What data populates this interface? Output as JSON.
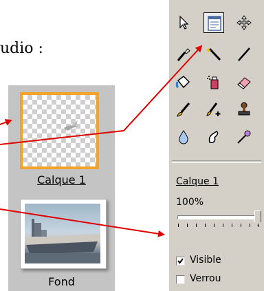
{
  "intro_text": "udio :",
  "layers_panel": {
    "items": [
      {
        "label": "Calque 1",
        "selected": true
      },
      {
        "label": "Fond",
        "selected": false
      }
    ]
  },
  "toolbar": {
    "tools": [
      {
        "name": "pointer",
        "selected": false
      },
      {
        "name": "layer-properties",
        "selected": true
      },
      {
        "name": "move",
        "selected": false
      },
      {
        "name": "eyedropper",
        "selected": false
      },
      {
        "name": "magic-wand",
        "selected": false
      },
      {
        "name": "line",
        "selected": false
      },
      {
        "name": "paint-bucket",
        "selected": false
      },
      {
        "name": "spray",
        "selected": false
      },
      {
        "name": "eraser",
        "selected": false
      },
      {
        "name": "brush",
        "selected": false
      },
      {
        "name": "brush-plus",
        "selected": false
      },
      {
        "name": "stamp",
        "selected": false
      },
      {
        "name": "drop",
        "selected": false
      },
      {
        "name": "smudge",
        "selected": false
      },
      {
        "name": "burn",
        "selected": false
      }
    ],
    "layer_name": "Calque 1",
    "opacity_text": "100%",
    "opacity_value": 1.0,
    "visible": {
      "label": "Visible",
      "checked": true
    },
    "lock": {
      "label": "Verrou",
      "checked": false
    }
  },
  "colors": {
    "selection_border": "#f3a22a",
    "arrow": "#e00000",
    "panel_bg": "#d4d0c8",
    "layers_bg": "#c4c4c4"
  }
}
